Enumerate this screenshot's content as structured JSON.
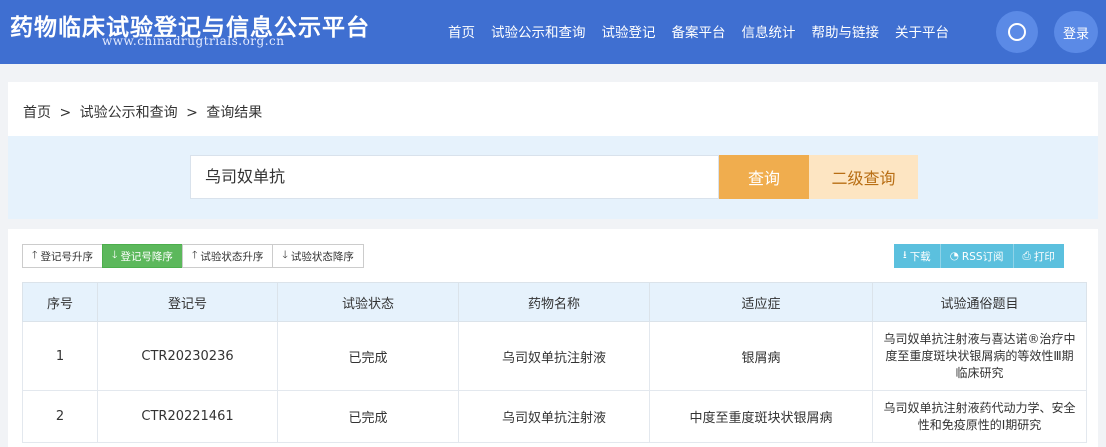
{
  "header": {
    "title": "药物临床试验登记与信息公示平台",
    "url": "www.chinadrugtrials.org.cn",
    "nav": [
      "首页",
      "试验公示和查询",
      "试验登记",
      "备案平台",
      "信息统计",
      "帮助与链接",
      "关于平台"
    ],
    "login_label": "登录"
  },
  "breadcrumb": [
    "首页",
    ">",
    "试验公示和查询",
    ">",
    "查询结果"
  ],
  "search": {
    "value": "乌司奴单抗",
    "query_label": "查询",
    "advanced_label": "二级查询"
  },
  "sort_buttons": [
    {
      "icon": "arrow-up-icon",
      "label": "登记号升序",
      "active": false
    },
    {
      "icon": "arrow-down-icon",
      "label": "登记号降序",
      "active": true
    },
    {
      "icon": "arrow-up-icon",
      "label": "试验状态升序",
      "active": false
    },
    {
      "icon": "arrow-down-icon",
      "label": "试验状态降序",
      "active": false
    }
  ],
  "actions": [
    {
      "icon": "download-icon",
      "label": "下载"
    },
    {
      "icon": "rss-icon",
      "label": "RSS订阅"
    },
    {
      "icon": "print-icon",
      "label": "打印"
    }
  ],
  "table": {
    "headers": [
      "序号",
      "登记号",
      "试验状态",
      "药物名称",
      "适应症",
      "试验通俗题目"
    ],
    "rows": [
      [
        "1",
        "CTR20230236",
        "已完成",
        "乌司奴单抗注射液",
        "银屑病",
        "乌司奴单抗注射液与喜达诺®治疗中度至重度斑块状银屑病的等效性Ⅲ期临床研究"
      ],
      [
        "2",
        "CTR20221461",
        "已完成",
        "乌司奴单抗注射液",
        "中度至重度斑块状银屑病",
        "乌司奴单抗注射液药代动力学、安全性和免疫原性的I期研究"
      ]
    ]
  },
  "colors": {
    "header_bg": "#3f6fd1",
    "query_btn": "#f0ad4e",
    "advanced_btn": "#fde5c2",
    "active_sort": "#5cb85c",
    "action_btn": "#5bc0de",
    "table_header_bg": "#e6f2fc"
  }
}
